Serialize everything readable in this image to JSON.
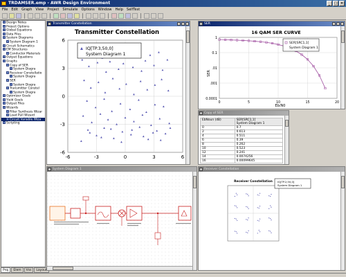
{
  "app": {
    "title": "TRDAMSER.emp - AWR Design Environment"
  },
  "menu": [
    "File",
    "Edit",
    "Graph",
    "View",
    "Project",
    "Simulate",
    "Options",
    "Window",
    "Help",
    "SelfTest"
  ],
  "browser": {
    "items": [
      {
        "label": "Design Notes",
        "level": 0
      },
      {
        "label": "Project Options",
        "level": 0
      },
      {
        "label": "Global Equations",
        "level": 0
      },
      {
        "label": "Data Files",
        "level": 0
      },
      {
        "label": "System Diagrams",
        "level": 0
      },
      {
        "label": "System Diagram 1",
        "level": 1
      },
      {
        "label": "Circuit Schematics",
        "level": 0
      },
      {
        "label": "EM Structures",
        "level": 0
      },
      {
        "label": "Conductor Materials",
        "level": 1
      },
      {
        "label": "Output Equations",
        "level": 0
      },
      {
        "label": "Graphs",
        "level": 0
      },
      {
        "label": "Copy of SER",
        "level": 1
      },
      {
        "label": "System Diagra",
        "level": 2
      },
      {
        "label": "Receiver Constellatio",
        "level": 1
      },
      {
        "label": "System Diagra",
        "level": 2
      },
      {
        "label": "SER",
        "level": 1
      },
      {
        "label": "System Diagra",
        "level": 2
      },
      {
        "label": "Transmitter Constel",
        "level": 1
      },
      {
        "label": "System Diagra",
        "level": 2
      },
      {
        "label": "Optimizer Goals",
        "level": 0
      },
      {
        "label": "Yield Goals",
        "level": 0
      },
      {
        "label": "Output Files",
        "level": 0
      },
      {
        "label": "Wizards",
        "level": 0
      },
      {
        "label": "Filter Synthesis Wizar",
        "level": 1
      },
      {
        "label": "Load Pull Wizard",
        "level": 1
      },
      {
        "label": "Circuit Variable Wiza",
        "level": 1
      },
      {
        "label": "Scripting",
        "level": 0
      }
    ],
    "selected_index": 25,
    "tabs": [
      "Proj",
      "Elem",
      "Vss",
      "Layout"
    ]
  },
  "tx_window": {
    "title": "Transmitter Constellation",
    "plot_title": "Transmitter Constellation",
    "legend_marker": "IQ[TP.3,50,0]",
    "legend_source": "System Diagram 1"
  },
  "ser_window": {
    "title": "SER",
    "plot_title": "16 QAM SER CURVE",
    "legend_marker": "SER[SRC1,1]",
    "legend_source": "System Diagram 1",
    "ylabel": "SER",
    "xlabel": "Eb/N0"
  },
  "copy_window": {
    "title": "Copy of SER",
    "col1_header": "EbNoun (dB)",
    "col2_header": "SER[SRC1,1]",
    "col2_sub": "System Diagram 1",
    "rows": [
      [
        "0",
        "0.7"
      ],
      [
        "2",
        "0.613"
      ],
      [
        "4",
        "0.511"
      ],
      [
        "6",
        "0.39"
      ],
      [
        "8",
        "0.262"
      ],
      [
        "10",
        "0.523"
      ],
      [
        "12",
        "0.241"
      ],
      [
        "14",
        "0.0074256"
      ],
      [
        "16",
        "0.00099645"
      ]
    ]
  },
  "sys_window": {
    "title": "System Diagram 1"
  },
  "rx_window": {
    "title": "Receiver Constellation",
    "plot_title": "Receiver Constellation",
    "legend_marker": "IQ[TP.2,50,0]",
    "legend_source": "System Diagram 1"
  },
  "colors": {
    "plot_bg": "#ffffff",
    "marker": "#5a5ab4",
    "ser_line": "#a050a0",
    "grid": "#c8c8c8",
    "schematic_red": "#c81e1e"
  },
  "chart_data": [
    {
      "type": "scatter",
      "title": "Transmitter Constellation",
      "xlim": [
        -6,
        6
      ],
      "ylim": [
        -6,
        6
      ],
      "ticks": [
        "-6",
        "-3",
        "0",
        "3",
        "6"
      ],
      "legend": "IQ[TP.3,50,0] System Diagram 1",
      "series": [
        {
          "name": "IQ[TP.3,50,0]",
          "x": [
            -4.5,
            -4.1,
            -3.8,
            -3.3,
            -2.9,
            -2.4,
            -2.0,
            -1.6,
            -1.1,
            -0.7,
            -0.2,
            0.3,
            0.8,
            1.2,
            1.7,
            2.1,
            2.6,
            3.0,
            3.5,
            3.9,
            4.4,
            -4.3,
            -3.6,
            -2.8,
            -2.1,
            -1.3,
            -0.6,
            0.1,
            0.9,
            1.6,
            2.3,
            3.1,
            3.8,
            4.5,
            -4.0,
            -3.1,
            -2.2,
            -1.4,
            -0.5,
            0.5,
            1.4,
            2.2,
            3.1,
            4.0,
            -4.4,
            -3.5,
            -2.6,
            -1.8,
            -0.9,
            0.0,
            0.9,
            1.8,
            2.7,
            3.6,
            4.6,
            -3.9,
            -3.0,
            -2.2,
            -1.2,
            -0.3,
            0.6,
            1.5,
            2.4,
            3.3,
            4.2,
            -4.6,
            -3.7,
            -2.5,
            -1.5,
            -0.4,
            0.7,
            1.9,
            2.9,
            3.7,
            4.7
          ],
          "y": [
            3.9,
            4.5,
            3.2,
            4.8,
            3.6,
            4.1,
            2.6,
            3.7,
            4.4,
            2.9,
            3.5,
            4.6,
            3.1,
            4.2,
            2.7,
            3.8,
            4.4,
            3.3,
            4.7,
            2.8,
            3.9,
            1.7,
            0.9,
            1.5,
            0.4,
            1.9,
            0.8,
            1.3,
            0.2,
            1.6,
            0.7,
            1.2,
            1.8,
            0.6,
            -0.5,
            -1.2,
            -0.3,
            -1.6,
            -0.8,
            -1.4,
            -0.4,
            -1.7,
            -0.9,
            -1.1,
            -2.1,
            -2.8,
            -1.9,
            -2.5,
            -3.0,
            -2.3,
            -2.7,
            -2.0,
            -3.1,
            -2.4,
            -2.9,
            -3.6,
            -4.2,
            -3.4,
            -4.5,
            -3.8,
            -4.1,
            -3.3,
            -4.6,
            -3.7,
            -4.0,
            -4.8,
            -3.9,
            -4.4,
            -3.5,
            -4.9,
            -3.6,
            -4.3,
            -3.9,
            -4.7,
            -3.4
          ]
        }
      ]
    },
    {
      "type": "line",
      "title": "16 QAM SER CURVE",
      "xlabel": "Eb/N0",
      "ylabel": "SER",
      "xlim": [
        0,
        20
      ],
      "ylim": [
        0.0001,
        1
      ],
      "yscale": "log",
      "xticks": [
        "0",
        "5",
        "10",
        "15",
        "20"
      ],
      "yticks": [
        "1",
        "0.1",
        ".01",
        ".001",
        "0.0001"
      ],
      "legend": "SER[SRC1,1] System Diagram 1",
      "series": [
        {
          "name": "SER[SRC1,1]",
          "x": [
            0,
            1,
            2,
            3,
            4,
            5,
            6,
            7,
            8,
            9,
            10,
            11,
            12,
            13,
            14,
            15,
            16,
            17,
            18
          ],
          "y": [
            0.72,
            0.7,
            0.68,
            0.66,
            0.63,
            0.6,
            0.56,
            0.52,
            0.47,
            0.41,
            0.34,
            0.27,
            0.2,
            0.13,
            0.074,
            0.036,
            0.013,
            0.0032,
            0.00046
          ]
        }
      ]
    },
    {
      "type": "table",
      "title": "Copy of SER",
      "columns": [
        "EbNoun (dB)",
        "SER[SRC1,1]"
      ],
      "rows": [
        [
          "0",
          "0.7"
        ],
        [
          "2",
          "0.613"
        ],
        [
          "4",
          "0.511"
        ],
        [
          "6",
          "0.39"
        ],
        [
          "8",
          "0.262"
        ],
        [
          "10",
          "0.523"
        ],
        [
          "12",
          "0.241"
        ],
        [
          "14",
          "0.0074256"
        ],
        [
          "16",
          "0.00099645"
        ]
      ]
    },
    {
      "type": "scatter",
      "title": "Receiver Constellation",
      "legend": "IQ[TP.2,50,0] System Diagram 1",
      "series": [
        {
          "name": "IQ[TP.2,50,0]",
          "x": [
            -3,
            -1,
            1,
            3,
            -3,
            -1,
            1,
            3,
            -3,
            -1,
            1,
            3,
            -3,
            -1,
            1,
            3
          ],
          "y": [
            3,
            3,
            3,
            3,
            1,
            1,
            1,
            1,
            -1,
            -1,
            -1,
            -1,
            -3,
            -3,
            -3,
            -3
          ]
        }
      ]
    }
  ]
}
